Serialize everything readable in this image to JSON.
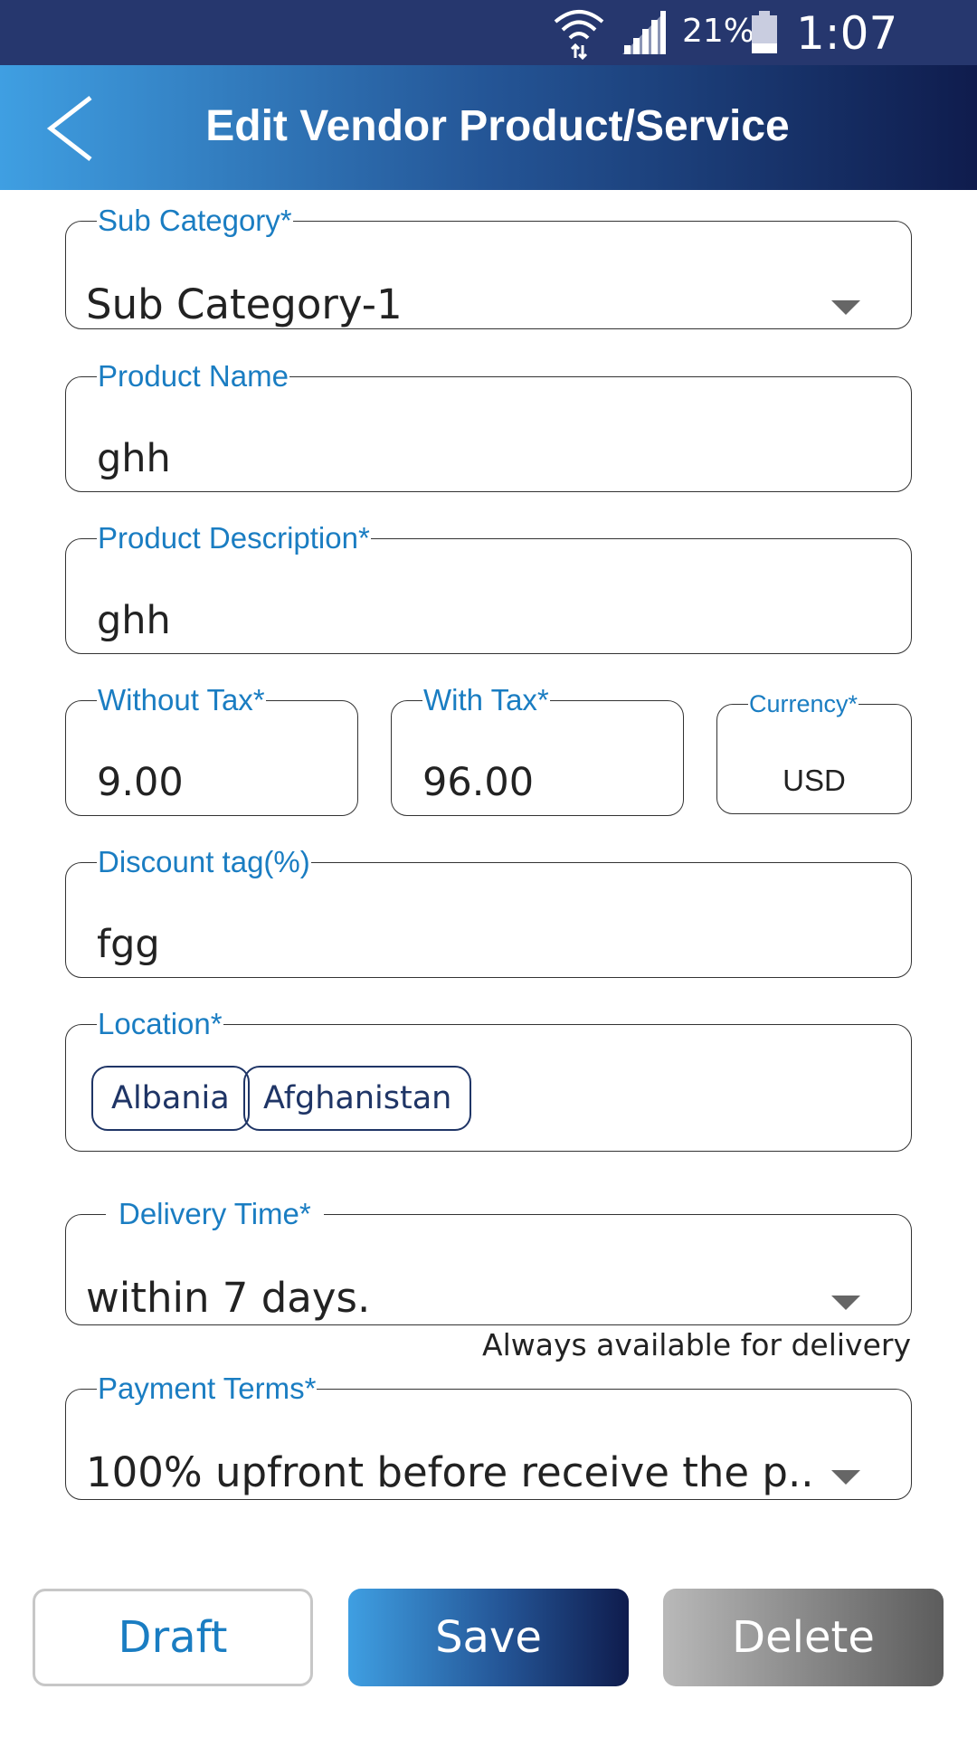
{
  "status_bar": {
    "battery_percent": "21%",
    "time": "1:07 PM",
    "icons": [
      "wifi-icon",
      "signal-icon",
      "battery-icon"
    ]
  },
  "app_bar": {
    "title": "Edit Vendor Product/Service",
    "back_icon": "back-arrow-icon"
  },
  "form": {
    "sub_category": {
      "label": "Sub Category*",
      "value": "Sub Category-1"
    },
    "product_name": {
      "label": "Product Name",
      "value": "ghh"
    },
    "product_description": {
      "label": "Product Description*",
      "value": "ghh"
    },
    "without_tax": {
      "label": "Without Tax*",
      "value": "9.00"
    },
    "with_tax": {
      "label": "With Tax*",
      "value": "96.00"
    },
    "currency": {
      "label": "Currency*",
      "value": "USD"
    },
    "discount_tag": {
      "label": "Discount tag(%)",
      "value": "fgg"
    },
    "location": {
      "label": "Location*",
      "chips": [
        "Albania",
        "Afghanistan"
      ]
    },
    "delivery_time": {
      "label": "Delivery Time*",
      "value": "within 7 days.",
      "helper": "Always available for delivery"
    },
    "payment_terms": {
      "label": "Payment Terms*",
      "value": "100% upfront before receive the p.."
    }
  },
  "actions": {
    "draft": "Draft",
    "save": "Save",
    "delete": "Delete"
  },
  "colors": {
    "status_bar": "#26376e",
    "label_blue": "#1a7dc2",
    "chip_border": "#1f3566"
  }
}
